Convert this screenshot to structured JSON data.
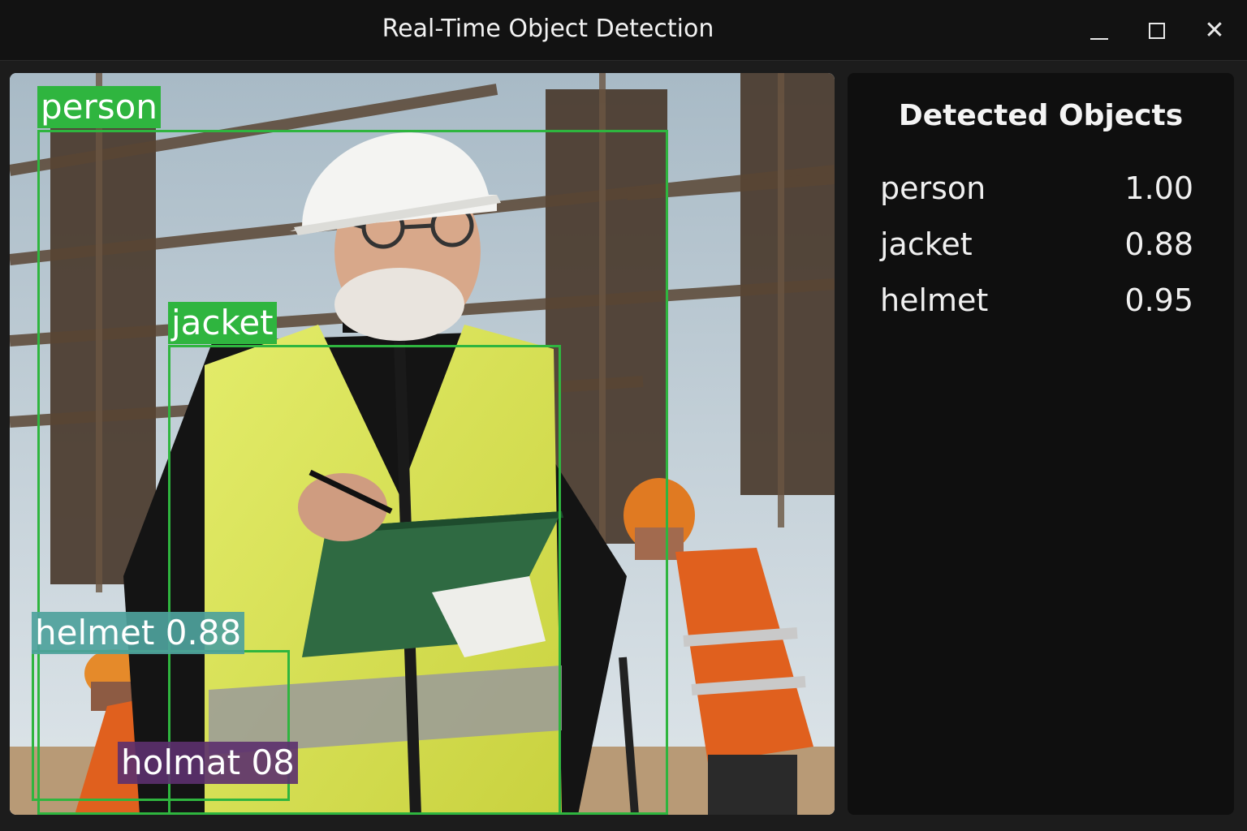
{
  "window": {
    "title": "Real-Time Object Detection",
    "controls": [
      "minimize-icon",
      "maximize-icon",
      "close-icon"
    ],
    "close_glyph": "✕"
  },
  "feed": {
    "boxes": [
      {
        "label": "person",
        "color": "#2fb53f"
      },
      {
        "label": "jacket",
        "color": "#2fb53f"
      },
      {
        "label": "helmet 0.88",
        "color": "#4ea29c"
      },
      {
        "label": "holmat 08",
        "color": "#5c306e"
      }
    ]
  },
  "panel": {
    "title": "Detected Objects",
    "items": [
      {
        "name": "person",
        "score": "1.00"
      },
      {
        "name": "jacket",
        "score": "0.88"
      },
      {
        "name": "helmet",
        "score": "0.95"
      }
    ]
  },
  "colors": {
    "accent_green": "#2fb53f",
    "panel_bg": "#0f0f0f",
    "titlebar_bg": "#121212"
  }
}
